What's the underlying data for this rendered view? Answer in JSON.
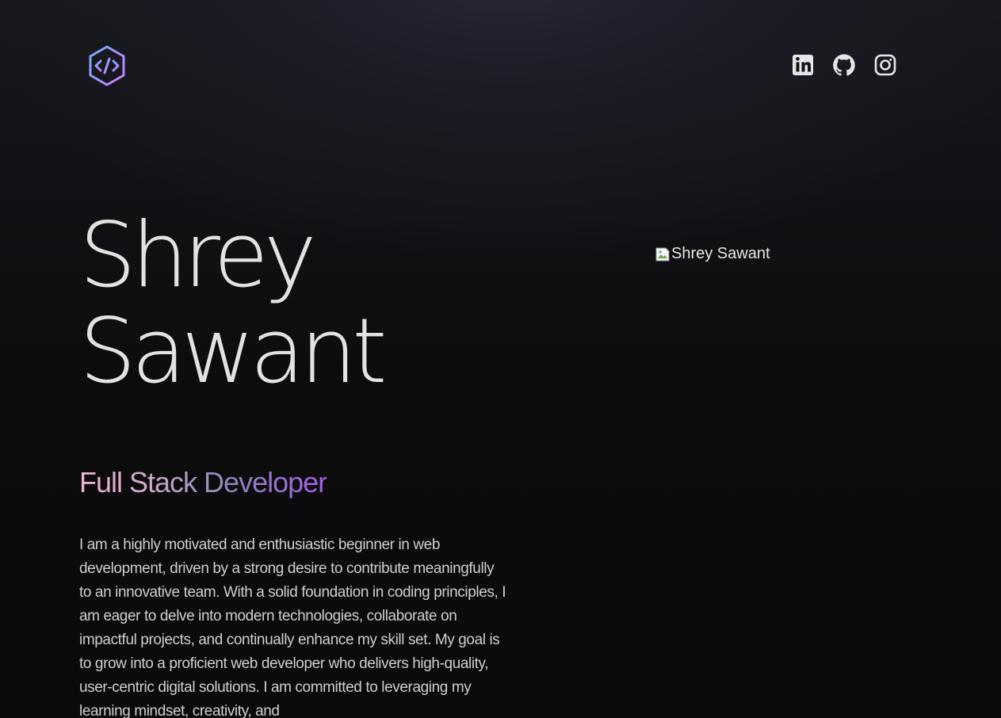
{
  "header": {
    "logo": {
      "icon": "code-hexagon-icon",
      "colors": [
        "#7aa8ff",
        "#c77dff"
      ]
    },
    "social": [
      {
        "name": "linkedin",
        "icon": "linkedin-icon"
      },
      {
        "name": "github",
        "icon": "github-icon"
      },
      {
        "name": "instagram",
        "icon": "instagram-icon"
      }
    ]
  },
  "hero": {
    "name_first": "Shrey",
    "name_last": "Sawant",
    "photo_alt": "Shrey Sawant",
    "title": "Full Stack Developer",
    "bio": "I am a highly motivated and enthusiastic beginner in web development, driven by a strong desire to contribute meaningfully to an innovative team. With a solid foundation in coding principles, I am eager to delve into modern technologies, collaborate on impactful projects, and continually enhance my skill set. My goal is to grow into a proficient web developer who delivers high-quality, user-centric digital solutions. I am committed to leveraging my learning mindset, creativity, and"
  },
  "colors": {
    "background": "#0b0b0d",
    "text": "#e2e2e2",
    "accent_gradient": [
      "#f2b2d0",
      "#8a86b8",
      "#a25ee8"
    ]
  }
}
